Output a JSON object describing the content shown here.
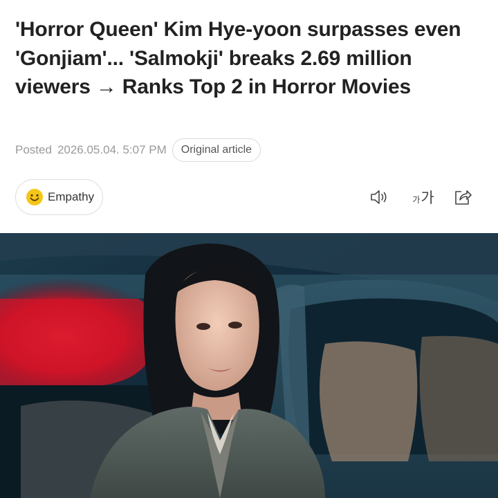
{
  "article": {
    "headline": "'Horror Queen' Kim Hye-yoon surpasses even 'Gonjiam'... 'Salmokji' breaks 2.69 million viewers → Ranks Top 2 in Horror Movies",
    "posted_label": "Posted",
    "posted_date": "2026.05.04. 5:07 PM",
    "original_article_label": "Original article"
  },
  "actions": {
    "empathy_label": "Empathy",
    "fontsize_small": "가",
    "fontsize_large": "가"
  },
  "icons": {
    "empathy": "smile-icon",
    "speaker": "speaker-icon",
    "fontsize": "font-size-icon",
    "share": "share-icon"
  },
  "colors": {
    "headline": "#222222",
    "meta": "#9a9a9a",
    "smile_yellow": "#f5c518"
  }
}
